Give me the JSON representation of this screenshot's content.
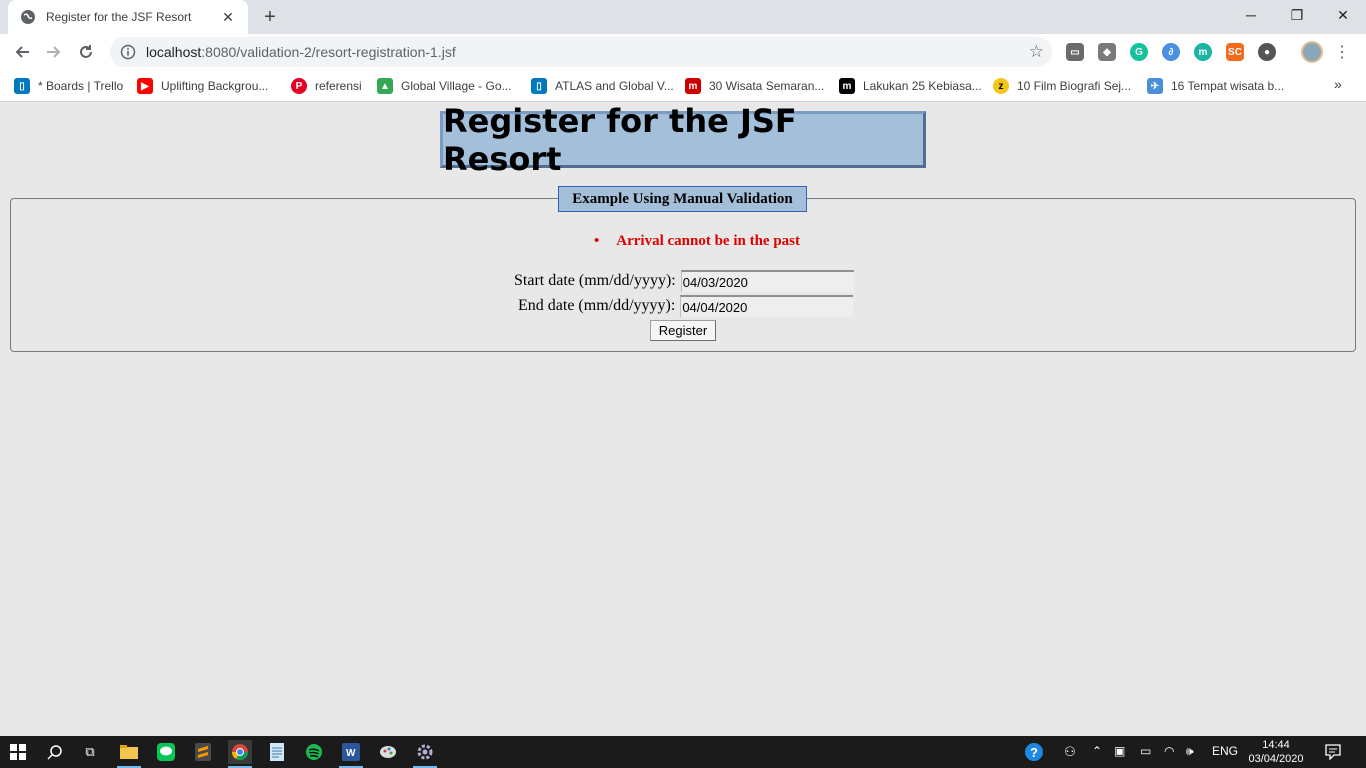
{
  "browser": {
    "tab_title": "Register for the JSF Resort",
    "tab_close": "✕",
    "new_tab": "+",
    "url_host": "localhost",
    "url_rest": ":8080/validation-2/resort-registration-1.jsf",
    "window_min": "─",
    "window_restore": "❐",
    "window_close": "✕",
    "bookmarks": [
      {
        "label": "* Boards | Trello",
        "icon": "trello-icon",
        "color": "#0079bf"
      },
      {
        "label": "Uplifting Backgrou...",
        "icon": "youtube-icon",
        "color": "#ff0000"
      },
      {
        "label": "referensi",
        "icon": "pinterest-icon",
        "color": "#e60023"
      },
      {
        "label": "Global Village - Go...",
        "icon": "google-drive-icon",
        "color": "#34a853"
      },
      {
        "label": "ATLAS and Global V...",
        "icon": "trello-icon",
        "color": "#0079bf"
      },
      {
        "label": "30 Wisata Semaran...",
        "icon": "m-logo-icon",
        "color": "#cc0000"
      },
      {
        "label": "Lakukan 25 Kebiasa...",
        "icon": "m-black-icon",
        "color": "#000000"
      },
      {
        "label": "10 Film Biografi Sej...",
        "icon": "z-coin-icon",
        "color": "#f5c518"
      },
      {
        "label": "16 Tempat wisata b...",
        "icon": "bird-icon",
        "color": "#4a90d9"
      }
    ],
    "bookmarks_more": "»"
  },
  "page": {
    "title": "Register for the JSF Resort",
    "legend": "Example Using Manual Validation",
    "error_message": "Arrival cannot be in the past",
    "start_label": "Start date (mm/dd/yyyy):",
    "start_value": "04/03/2020",
    "end_label": "End date (mm/dd/yyyy):",
    "end_value": "04/04/2020",
    "register_label": "Register"
  },
  "taskbar": {
    "language": "ENG",
    "time": "14:44",
    "date": "03/04/2020"
  },
  "colors": {
    "title_bg": "#a4bfd9",
    "error": "#e00000",
    "page_bg": "#e8e8e8"
  }
}
